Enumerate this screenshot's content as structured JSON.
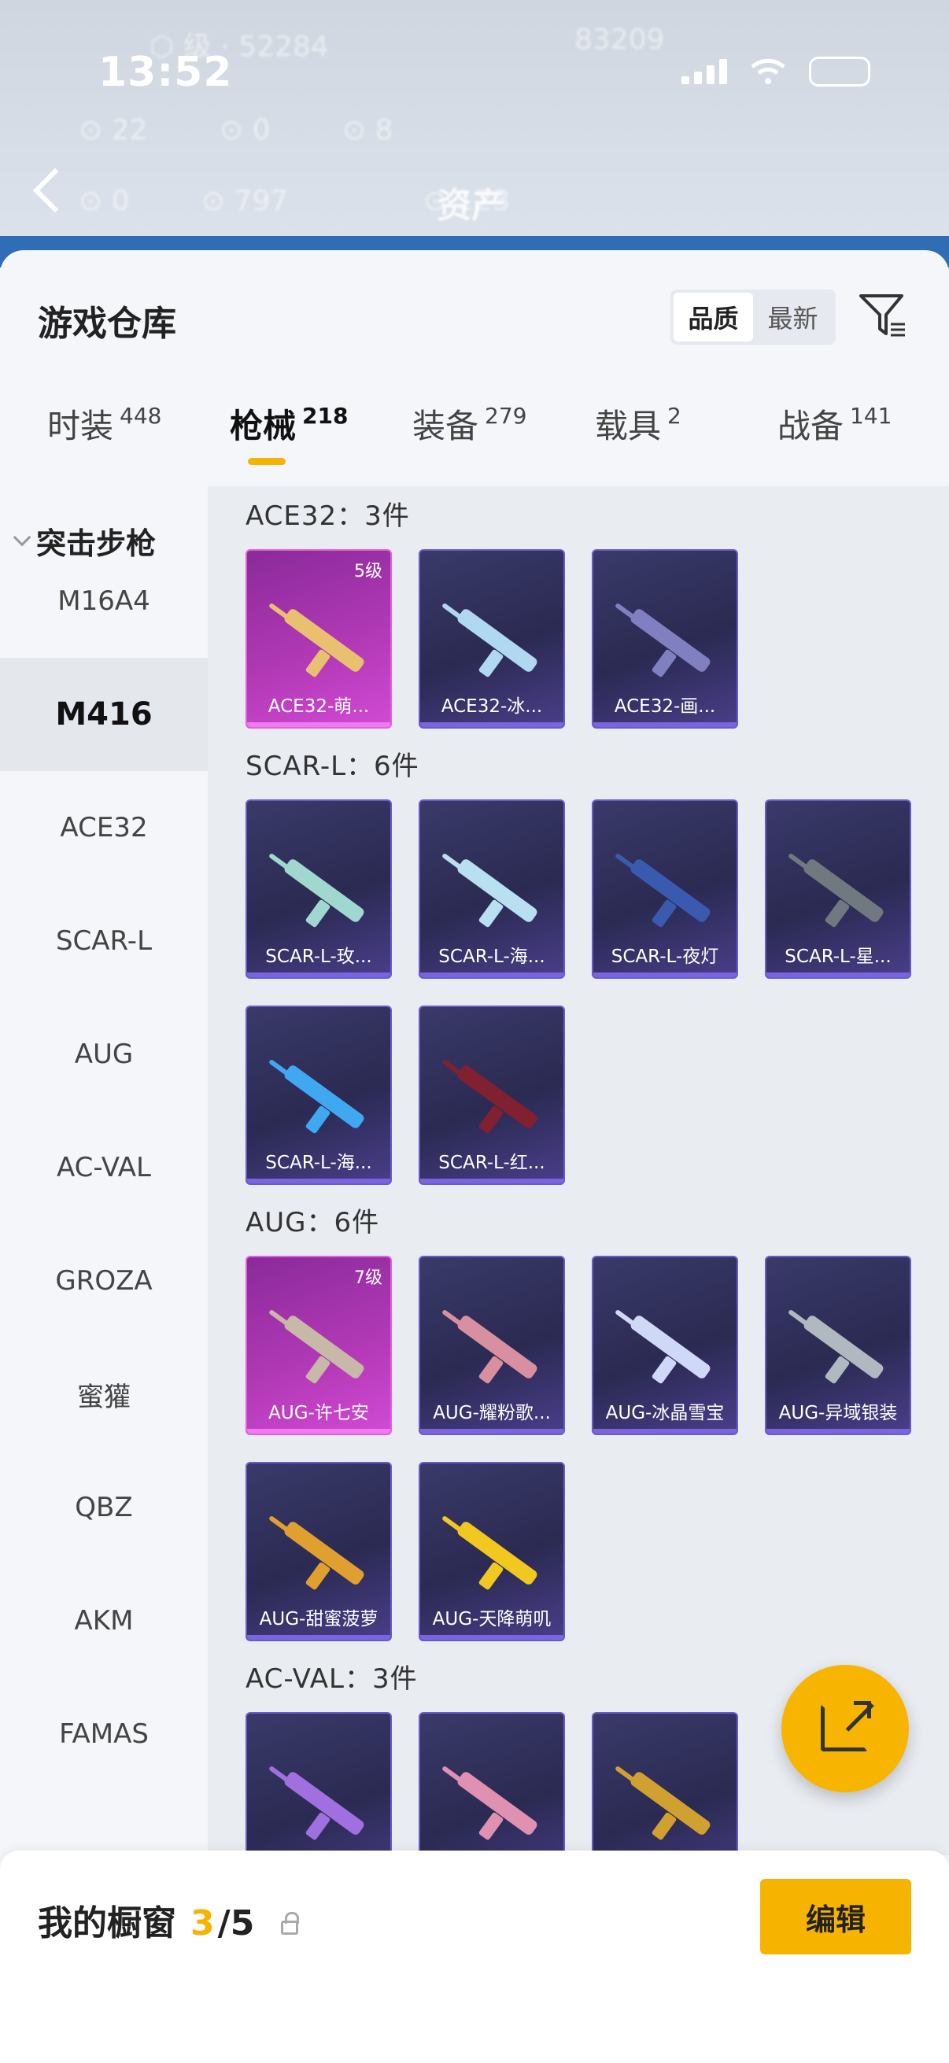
{
  "status": {
    "time": "13:52"
  },
  "header": {
    "title": "资产"
  },
  "warehouse": {
    "title": "游戏仓库",
    "sort": {
      "quality": "品质",
      "newest": "最新"
    }
  },
  "tabs": [
    {
      "label": "时装",
      "count": "448"
    },
    {
      "label": "枪械",
      "count": "218"
    },
    {
      "label": "装备",
      "count": "279"
    },
    {
      "label": "载具",
      "count": "2"
    },
    {
      "label": "战备",
      "count": "141"
    }
  ],
  "sidebar": {
    "category": "突击步枪",
    "items": [
      "M16A4",
      "M416",
      "ACE32",
      "SCAR-L",
      "AUG",
      "AC-VAL",
      "GROZA",
      "蜜獾",
      "QBZ",
      "AKM",
      "FAMAS"
    ]
  },
  "groups": [
    {
      "title": "ACE32：3件",
      "items": [
        {
          "name": "ACE32-萌...",
          "level": "5级",
          "rarity": "legend",
          "color": "#e8c070"
        },
        {
          "name": "ACE32-冰...",
          "level": "",
          "rarity": "epic",
          "color": "#b0d8f0"
        },
        {
          "name": "ACE32-画...",
          "level": "",
          "rarity": "epic",
          "color": "#8080c0"
        }
      ]
    },
    {
      "title": "SCAR-L：6件",
      "items": [
        {
          "name": "SCAR-L-玫...",
          "level": "",
          "rarity": "epic",
          "color": "#a0d8d0"
        },
        {
          "name": "SCAR-L-海...",
          "level": "",
          "rarity": "epic",
          "color": "#b8e0f0"
        },
        {
          "name": "SCAR-L-夜灯",
          "level": "",
          "rarity": "epic",
          "color": "#3a5ab0"
        },
        {
          "name": "SCAR-L-星...",
          "level": "",
          "rarity": "epic",
          "color": "#707880"
        },
        {
          "name": "SCAR-L-海...",
          "level": "",
          "rarity": "epic",
          "color": "#40a8f0"
        },
        {
          "name": "SCAR-L-红...",
          "level": "",
          "rarity": "epic",
          "color": "#802030"
        }
      ]
    },
    {
      "title": "AUG：6件",
      "items": [
        {
          "name": "AUG-许七安",
          "level": "7级",
          "rarity": "legend",
          "color": "#c8b8a8"
        },
        {
          "name": "AUG-耀粉歌...",
          "level": "",
          "rarity": "epic",
          "color": "#d890a0"
        },
        {
          "name": "AUG-冰晶雪宝",
          "level": "",
          "rarity": "epic",
          "color": "#d0d8f8"
        },
        {
          "name": "AUG-异域银装",
          "level": "",
          "rarity": "epic",
          "color": "#b0b8c0"
        },
        {
          "name": "AUG-甜蜜菠萝",
          "level": "",
          "rarity": "epic",
          "color": "#e0a030"
        },
        {
          "name": "AUG-天降萌叽",
          "level": "",
          "rarity": "epic",
          "color": "#f0c820"
        }
      ]
    },
    {
      "title": "AC-VAL：3件",
      "items": [
        {
          "name": "",
          "level": "",
          "rarity": "epic",
          "color": "#a070e0"
        },
        {
          "name": "",
          "level": "",
          "rarity": "epic",
          "color": "#e090b0"
        },
        {
          "name": "",
          "level": "",
          "rarity": "epic",
          "color": "#d0a030"
        }
      ]
    }
  ],
  "showcase": {
    "label": "我的橱窗",
    "current": "3",
    "total": "/5",
    "edit": "编辑"
  },
  "colors": {
    "accent": "#f6b400",
    "epic_border": "#6a5ad0",
    "legend_bg": "#b43ab8"
  }
}
